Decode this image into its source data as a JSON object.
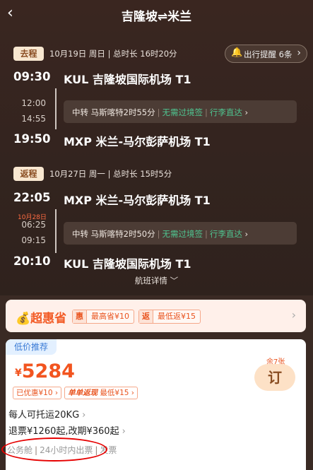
{
  "header": {
    "title": "吉隆坡⇌米兰",
    "back_icon": "‹"
  },
  "reminder": {
    "label": "出行提醒 6条",
    "icon": "bell-icon"
  },
  "outbound": {
    "tag": "去程",
    "meta": "10月19日 周日 | 总时长 16时20分",
    "depart_time": "09:30",
    "depart_airport": "KUL 吉隆坡国际机场 T1",
    "stop_arrive": "12:00",
    "stop_depart": "14:55",
    "transfer": {
      "label": "中转 马斯喀特2时55分",
      "visa": "无需过境签",
      "luggage": "行李直达"
    },
    "arrive_time": "19:50",
    "arrive_airport": "MXP 米兰-马尔彭萨机场 T1"
  },
  "return": {
    "tag": "返程",
    "meta": "10月27日 周一 | 总时长 15时5分",
    "depart_time": "22:05",
    "depart_airport": "MXP 米兰-马尔彭萨机场 T1",
    "next_day": "10月28日",
    "stop_arrive": "06:25",
    "stop_depart": "09:15",
    "transfer": {
      "label": "中转 马斯喀特2时50分",
      "visa": "无需过境签",
      "luggage": "行李直达"
    },
    "arrive_time": "20:10",
    "arrive_airport": "KUL 吉隆坡国际机场 T1"
  },
  "flight_detail": "航班详情 ﹀",
  "promo": {
    "brand": "超惠省",
    "badge1_label": "惠",
    "badge1_value": "最高省¥10",
    "badge2_label": "返",
    "badge2_value": "最低返¥15"
  },
  "offer": {
    "tag": "低价推荐",
    "currency": "¥",
    "price": "5284",
    "chip1": "已优惠¥10 ›",
    "chip2_bold": "单单返现",
    "chip2_rest": "最低¥15 ›",
    "baggage": "每人可托运20KG",
    "refund": "退票¥1260起,改期¥360起",
    "cabin": "公务舱",
    "ticketing": "24小时内出票",
    "extra": "发票",
    "remaining": "余7张",
    "book": "订"
  },
  "colors": {
    "accent": "#f2541f",
    "green": "#4fc490",
    "background": "#3a2a24"
  }
}
